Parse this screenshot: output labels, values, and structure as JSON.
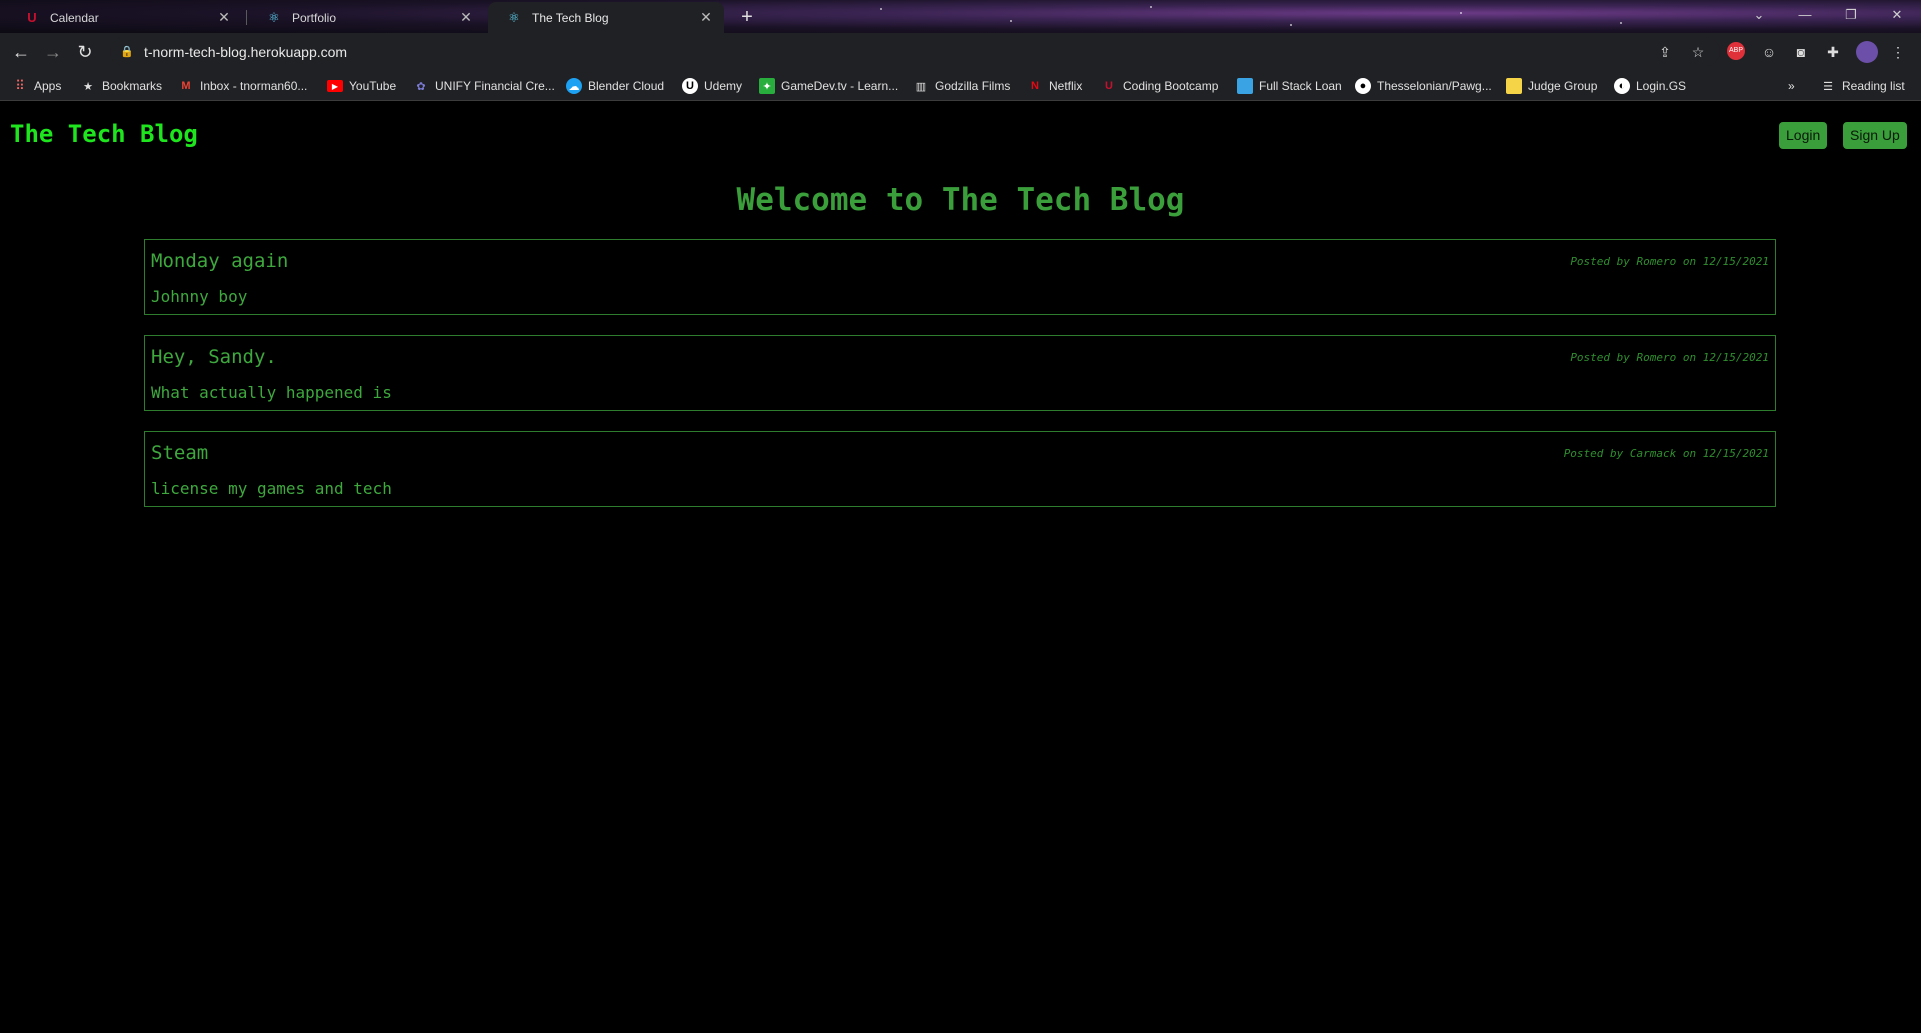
{
  "browser": {
    "tabs": [
      {
        "title": "Calendar",
        "icon": "university-logo-icon",
        "active": false
      },
      {
        "title": "Portfolio",
        "icon": "react-logo-icon",
        "active": false
      },
      {
        "title": "The Tech Blog",
        "icon": "react-logo-icon",
        "active": true
      }
    ],
    "url": "t-norm-tech-blog.herokuapp.com",
    "bookmarks": [
      {
        "label": "Apps",
        "icon": "apps-grid-icon"
      },
      {
        "label": "Bookmarks",
        "icon": "star-icon"
      },
      {
        "label": "Inbox - tnorman60...",
        "icon": "gmail-icon"
      },
      {
        "label": "YouTube",
        "icon": "youtube-icon"
      },
      {
        "label": "UNIFY Financial Cre...",
        "icon": "unify-icon"
      },
      {
        "label": "Blender Cloud",
        "icon": "cloud-icon"
      },
      {
        "label": "Udemy",
        "icon": "udemy-icon"
      },
      {
        "label": "GameDev.tv - Learn...",
        "icon": "gamedev-icon"
      },
      {
        "label": "Godzilla Films",
        "icon": "building-icon"
      },
      {
        "label": "Netflix",
        "icon": "netflix-icon"
      },
      {
        "label": "Coding Bootcamp",
        "icon": "university-logo-icon"
      },
      {
        "label": "Full Stack Loan",
        "icon": "blue-square-icon"
      },
      {
        "label": "Thesselonian/Pawg...",
        "icon": "github-icon"
      },
      {
        "label": "Judge Group",
        "icon": "note-icon"
      },
      {
        "label": "Login.GS",
        "icon": "globe-icon"
      }
    ],
    "reading_list": "Reading list",
    "overflow": "»"
  },
  "site": {
    "title": "The Tech Blog",
    "login": "Login",
    "signup": "Sign Up",
    "welcome": "Welcome to The Tech Blog"
  },
  "posts": [
    {
      "title": "Monday again",
      "meta": "Posted by Romero on 12/15/2021",
      "body": "Johnny boy"
    },
    {
      "title": "Hey, Sandy.",
      "meta": "Posted by Romero on 12/15/2021",
      "body": "What actually happened is"
    },
    {
      "title": "Steam",
      "meta": "Posted by Carmack on 12/15/2021",
      "body": "license my games and tech"
    }
  ],
  "colors": {
    "site_title": "#1ee51e",
    "accent_green": "#3a9e3a",
    "background": "#000000"
  }
}
